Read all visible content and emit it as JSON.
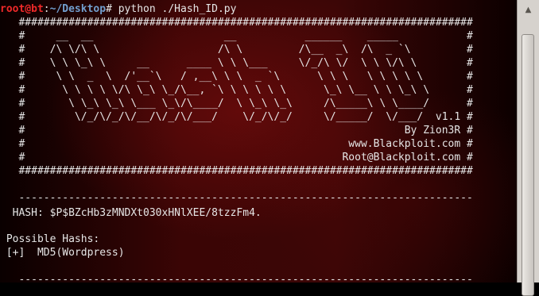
{
  "prompt": {
    "user_host": "root@bt",
    "separator": ":",
    "path": "~/Desktop",
    "symbol": "#",
    "command": " python ./Hash_ID.py"
  },
  "banner": [
    "   #########################################################################",
    "   #     __  __                     __           ______    _____           #",
    "   #    /\\ \\/\\ \\                   /\\ \\         /\\__  _\\  /\\  _ `\\         #",
    "   #    \\ \\ \\_\\ \\     __      ____ \\ \\ \\___     \\/_/\\ \\/  \\ \\ \\/\\ \\        #",
    "   #     \\ \\  _  \\  /'__`\\   / ,__\\ \\ \\  _ `\\      \\ \\ \\   \\ \\ \\ \\ \\       #",
    "   #      \\ \\ \\ \\ \\/\\ \\_\\ \\_/\\__, `\\ \\ \\ \\ \\ \\      \\_\\ \\__ \\ \\ \\_\\ \\      #",
    "   #       \\ \\_\\ \\_\\ \\___ \\_\\/\\____/  \\ \\_\\ \\_\\     /\\_____\\ \\ \\____/      #",
    "   #        \\/_/\\/_/\\/__/\\/_/\\/___/    \\/_/\\/_/     \\/_____/  \\/___/  v1.1 #",
    "   #                                                             By Zion3R #",
    "   #                                                    www.Blackploit.com #",
    "   #                                                   Root@Blackploit.com #",
    "   #########################################################################"
  ],
  "separator_top": "   -------------------------------------------------------------------------",
  "hash_line": "  HASH: $P$BZcHb3zMNDXt030xHNlXEE/8tzzFm4.",
  "possible_label": " Possible Hashs:",
  "result_line": " [+]  MD5(Wordpress)",
  "separator_bottom": "   -------------------------------------------------------------------------",
  "scrollbar": {
    "up_icon": "▲",
    "down_icon": "▼"
  }
}
